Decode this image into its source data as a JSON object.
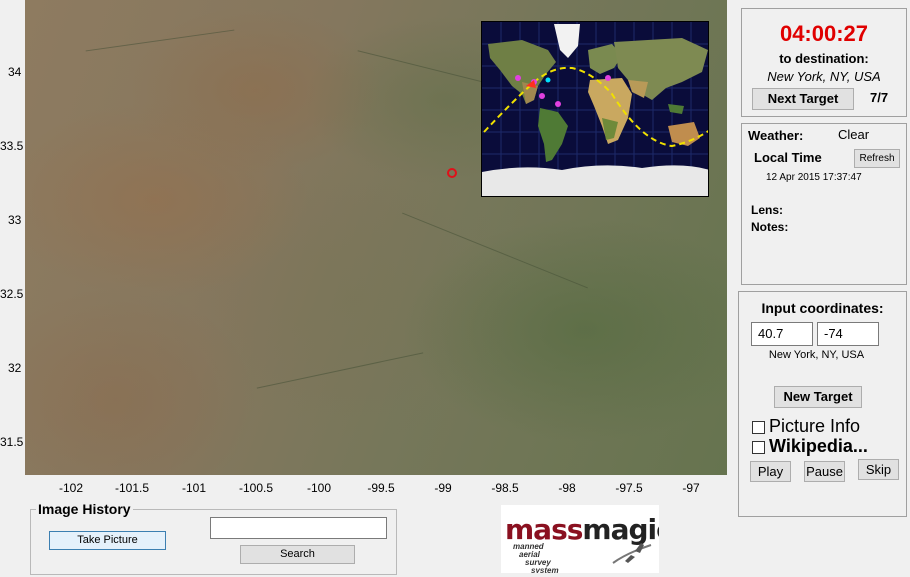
{
  "map": {
    "y_ticks": [
      "34",
      "33.5",
      "33",
      "32.5",
      "32",
      "31.5"
    ],
    "x_ticks": [
      "-102",
      "-101.5",
      "-101",
      "-100.5",
      "-100",
      "-99.5",
      "-99",
      "-98.5",
      "-98",
      "-97.5",
      "-97"
    ],
    "marker_color": "#e0101a"
  },
  "timer": {
    "countdown": "04:00:27",
    "countdown_color": "#e00000",
    "to_label": "to destination:",
    "destination": "New York, NY, USA",
    "next_target_label": "Next Target",
    "counter": "7/7"
  },
  "info": {
    "weather_label": "Weather:",
    "weather_value": "Clear",
    "local_time_label": "Local Time",
    "refresh_label": "Refresh",
    "local_time_value": "12 Apr 2015 17:37:47",
    "lens_label": "Lens:",
    "notes_label": "Notes:"
  },
  "coords": {
    "title": "Input coordinates:",
    "lat": "40.7",
    "lon": "-74",
    "place": "New York, NY, USA",
    "new_target_label": "New Target",
    "picture_info_label": "Picture Info",
    "wikipedia_label": "Wikipedia...",
    "play_label": "Play",
    "pause_label": "Pause",
    "skip_label": "Skip"
  },
  "history": {
    "title": "Image History",
    "take_picture_label": "Take Picture",
    "search_value": "",
    "search_label": "Search"
  },
  "logo": {
    "word_mass": "mass",
    "word_magic": "magic",
    "tagline_lines": [
      "manned",
      "aerial",
      "survey",
      "system"
    ]
  }
}
